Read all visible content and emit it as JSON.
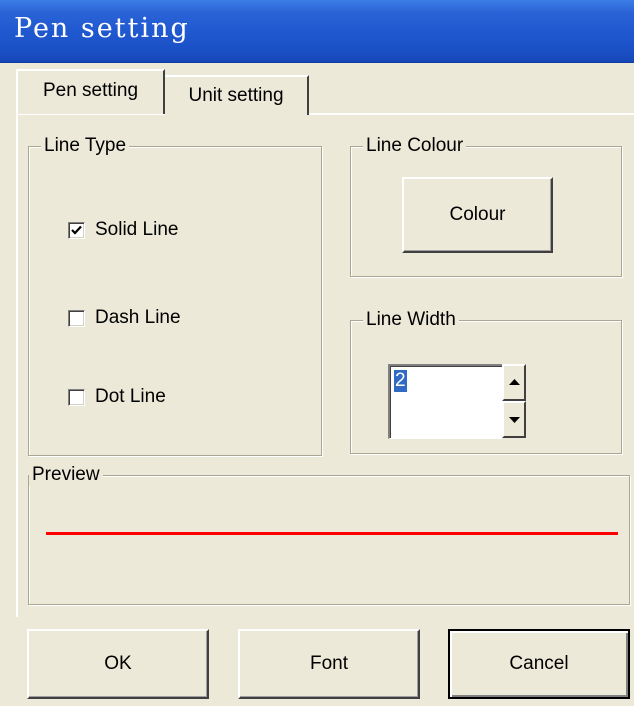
{
  "window": {
    "title": "Pen setting"
  },
  "tabs": [
    {
      "label": "Pen setting",
      "selected": true
    },
    {
      "label": "Unit setting",
      "selected": false
    }
  ],
  "line_type": {
    "label": "Line Type",
    "options": [
      {
        "label": "Solid Line",
        "checked": true
      },
      {
        "label": "Dash Line",
        "checked": false
      },
      {
        "label": "Dot Line",
        "checked": false
      }
    ]
  },
  "line_colour": {
    "label": "Line Colour",
    "button_label": "Colour"
  },
  "line_width": {
    "label": "Line Width",
    "value": "2"
  },
  "preview": {
    "label": "Preview",
    "line_color": "#ff0000"
  },
  "buttons": {
    "ok": "OK",
    "font": "Font",
    "cancel": "Cancel"
  },
  "colors": {
    "title_bar": "#2a63d6",
    "dialog_background": "#ece9d8",
    "selection": "#316ac5"
  }
}
